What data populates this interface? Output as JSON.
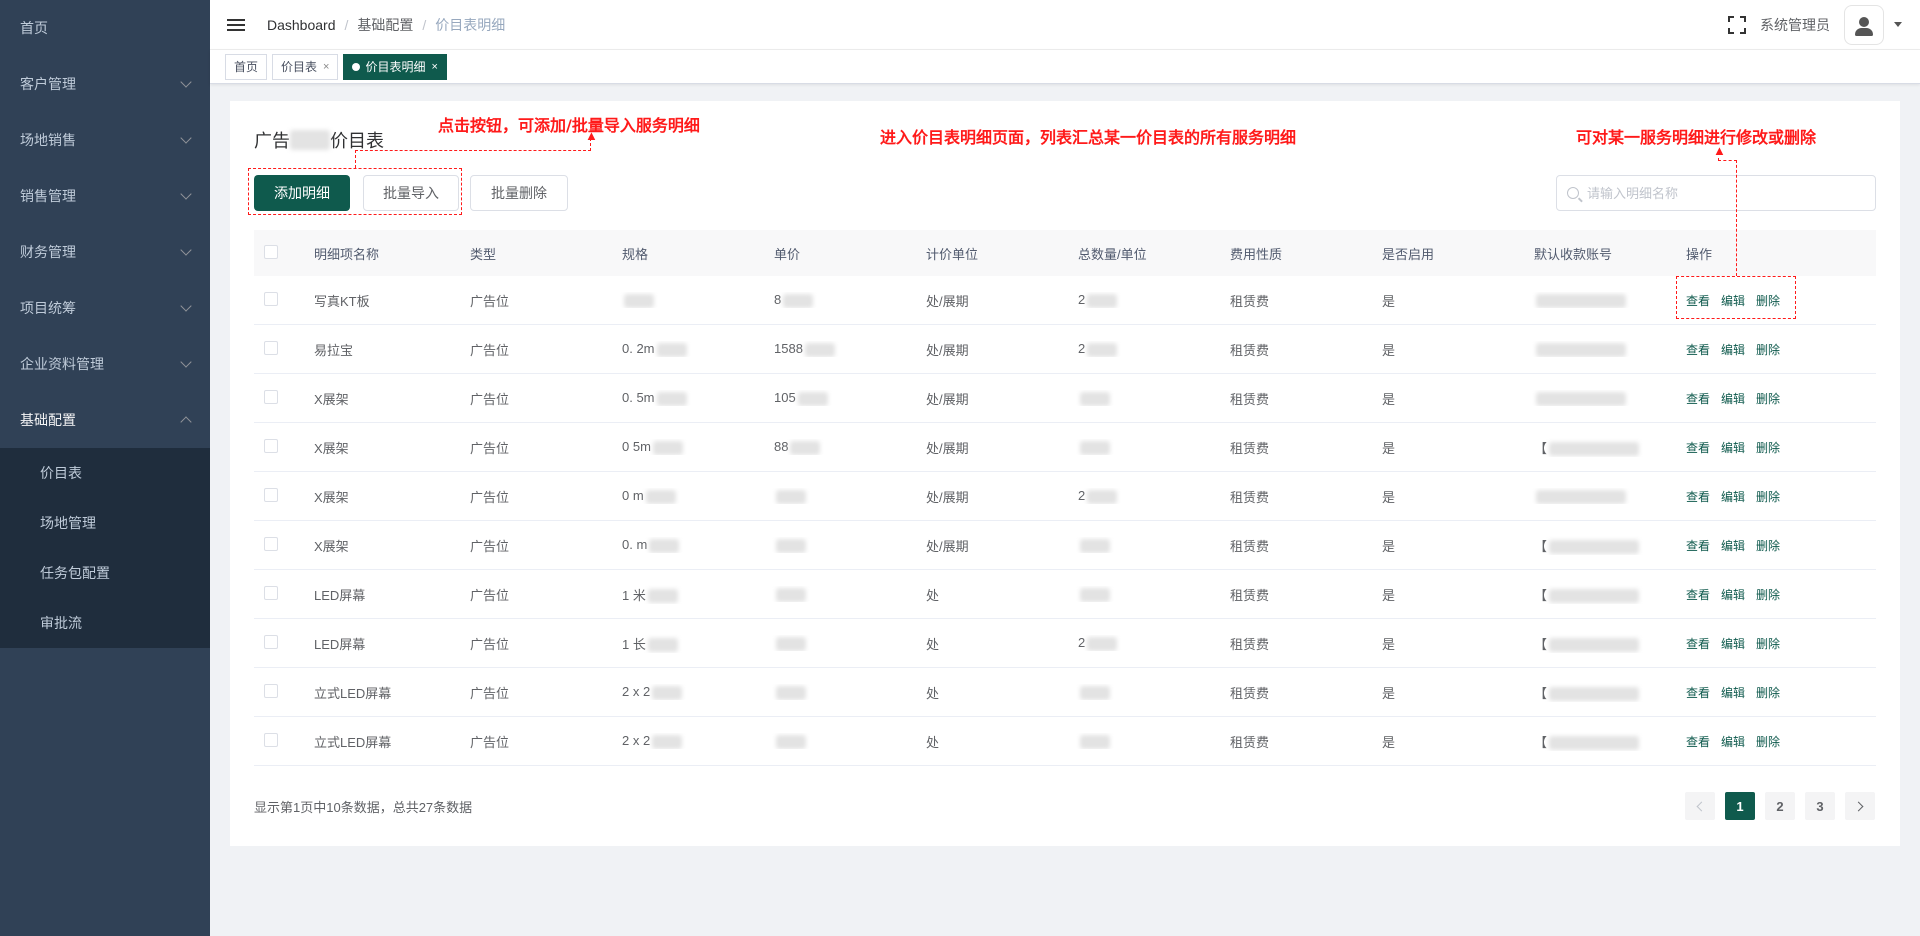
{
  "sidebar": {
    "items": [
      {
        "label": "首页",
        "expandable": false
      },
      {
        "label": "客户管理",
        "expandable": true
      },
      {
        "label": "场地销售",
        "expandable": true
      },
      {
        "label": "销售管理",
        "expandable": true
      },
      {
        "label": "财务管理",
        "expandable": true
      },
      {
        "label": "项目统筹",
        "expandable": true
      },
      {
        "label": "企业资料管理",
        "expandable": true
      },
      {
        "label": "基础配置",
        "expandable": true,
        "expanded": true
      }
    ],
    "submenu": [
      {
        "label": "价目表"
      },
      {
        "label": "场地管理"
      },
      {
        "label": "任务包配置"
      },
      {
        "label": "审批流"
      }
    ]
  },
  "navbar": {
    "breadcrumb": [
      "Dashboard",
      "基础配置",
      "价目表明细"
    ],
    "breadcrumb_sep": "/",
    "username": "系统管理员"
  },
  "tags": [
    {
      "label": "首页",
      "closable": false,
      "active": false
    },
    {
      "label": "价目表",
      "closable": true,
      "active": false
    },
    {
      "label": "价目表明细",
      "closable": true,
      "active": true
    }
  ],
  "tag_close": "×",
  "page": {
    "title_prefix": "广告",
    "title_suffix": "价目表",
    "buttons": {
      "add": "添加明细",
      "import": "批量导入",
      "delete": "批量删除"
    },
    "search_placeholder": "请输入明细名称"
  },
  "table": {
    "headers": [
      "明细项名称",
      "类型",
      "规格",
      "单价",
      "计价单位",
      "总数量/单位",
      "费用性质",
      "是否启用",
      "默认收款账号",
      "操作"
    ],
    "rows": [
      {
        "name": "写真KT板",
        "type": "广告位",
        "spec": "",
        "price": "8",
        "unit": "处/展期",
        "qty": "2",
        "fee": "租赁费",
        "enabled": "是",
        "account": ""
      },
      {
        "name": "易拉宝",
        "type": "广告位",
        "spec": "0.  2m",
        "price": "1588",
        "unit": "处/展期",
        "qty": "2",
        "fee": "租赁费",
        "enabled": "是",
        "account": ""
      },
      {
        "name": "X展架",
        "type": "广告位",
        "spec": "0.  5m",
        "price": "105",
        "unit": "处/展期",
        "qty": "",
        "fee": "租赁费",
        "enabled": "是",
        "account": ""
      },
      {
        "name": "X展架",
        "type": "广告位",
        "spec": "0  5m",
        "price": "88",
        "unit": "处/展期",
        "qty": "",
        "fee": "租赁费",
        "enabled": "是",
        "account": "【"
      },
      {
        "name": "X展架",
        "type": "广告位",
        "spec": "0  m",
        "price": "",
        "unit": "处/展期",
        "qty": "2",
        "fee": "租赁费",
        "enabled": "是",
        "account": ""
      },
      {
        "name": "X展架",
        "type": "广告位",
        "spec": "0.  m",
        "price": "",
        "unit": "处/展期",
        "qty": "",
        "fee": "租赁费",
        "enabled": "是",
        "account": "【"
      },
      {
        "name": "LED屏幕",
        "type": "广告位",
        "spec": "1  米",
        "price": "",
        "unit": "处",
        "qty": "",
        "fee": "租赁费",
        "enabled": "是",
        "account": "【"
      },
      {
        "name": "LED屏幕",
        "type": "广告位",
        "spec": "1  长",
        "price": "",
        "unit": "处",
        "qty": "2",
        "fee": "租赁费",
        "enabled": "是",
        "account": "【"
      },
      {
        "name": "立式LED屏幕",
        "type": "广告位",
        "spec": "2  x 2",
        "price": "",
        "unit": "处",
        "qty": "",
        "fee": "租赁费",
        "enabled": "是",
        "account": "【"
      },
      {
        "name": "立式LED屏幕",
        "type": "广告位",
        "spec": "2  x 2",
        "price": "",
        "unit": "处",
        "qty": "",
        "fee": "租赁费",
        "enabled": "是",
        "account": "【"
      }
    ],
    "ops": {
      "view": "查看",
      "edit": "编辑",
      "delete": "删除"
    }
  },
  "pagination": {
    "info": "显示第1页中10条数据，总共27条数据",
    "pages": [
      "1",
      "2",
      "3"
    ],
    "current": "1"
  },
  "annotations": {
    "add_hint": "点击按钮，可添加/批量导入服务明细",
    "list_hint": "进入价目表明细页面，列表汇总某一价目表的所有服务明细",
    "ops_hint": "可对某一服务明细进行修改或删除"
  },
  "colors": {
    "primary": "#0f5a4d",
    "sidebar": "#304156",
    "annotation": "#ff1a1a"
  }
}
